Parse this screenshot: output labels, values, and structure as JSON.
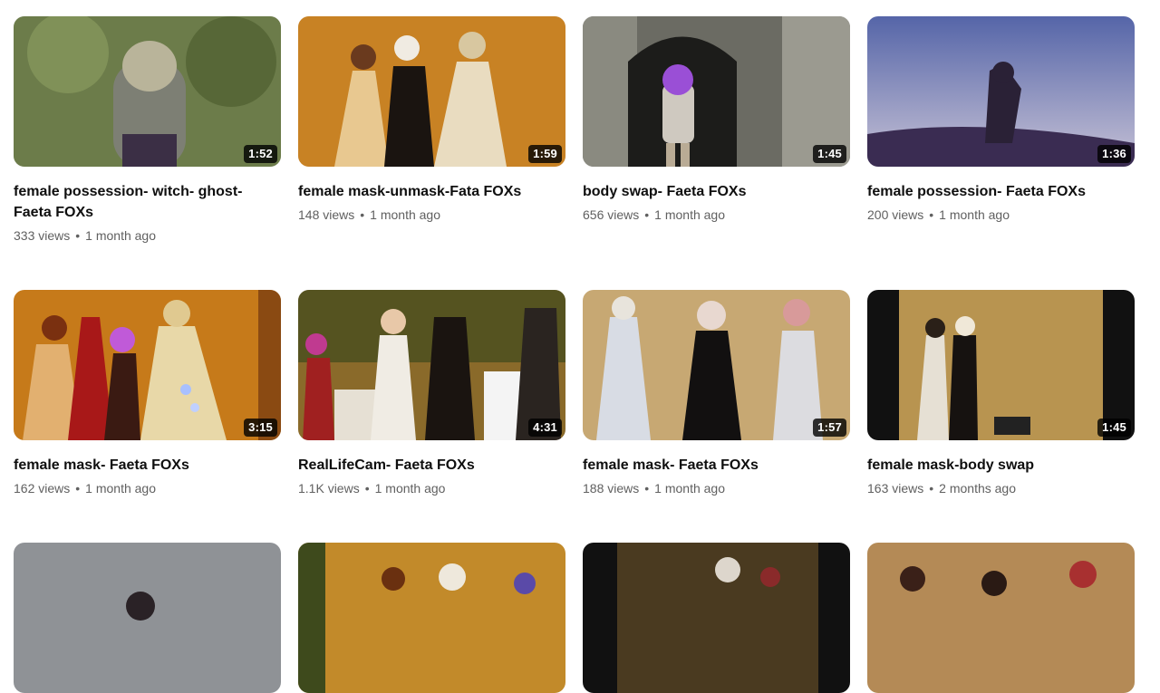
{
  "videos": [
    {
      "title": "female possession- witch- ghost- Faeta FOXs",
      "duration": "1:52",
      "views": "333 views",
      "age": "1 month ago",
      "bg": "#5c6e3e"
    },
    {
      "title": "female mask-unmask-Fata FOXs",
      "duration": "1:59",
      "views": "148 views",
      "age": "1 month ago",
      "bg": "#b8741e"
    },
    {
      "title": "body swap- Faeta FOXs",
      "duration": "1:45",
      "views": "656 views",
      "age": "1 month ago",
      "bg": "#6b6b63"
    },
    {
      "title": "female possession- Faeta FOXs",
      "duration": "1:36",
      "views": "200 views",
      "age": "1 month ago",
      "bg": "#7d86b3"
    },
    {
      "title": "female mask- Faeta FOXs",
      "duration": "3:15",
      "views": "162 views",
      "age": "1 month ago",
      "bg": "#c67a1a"
    },
    {
      "title": "RealLifeCam- Faeta FOXs",
      "duration": "4:31",
      "views": "1.1K views",
      "age": "1 month ago",
      "bg": "#8a6a2a"
    },
    {
      "title": "female mask- Faeta FOXs",
      "duration": "1:57",
      "views": "188 views",
      "age": "1 month ago",
      "bg": "#c7a873"
    },
    {
      "title": "female mask-body swap",
      "duration": "1:45",
      "views": "163 views",
      "age": "2 months ago",
      "bg": "#b89450"
    },
    {
      "title": "",
      "duration": "",
      "views": "",
      "age": "",
      "bg": "#8f9296"
    },
    {
      "title": "",
      "duration": "",
      "views": "",
      "age": "",
      "bg": "#c28a2a"
    },
    {
      "title": "",
      "duration": "",
      "views": "",
      "age": "",
      "bg": "#4a3a20"
    },
    {
      "title": "",
      "duration": "",
      "views": "",
      "age": "",
      "bg": "#b48a56"
    }
  ]
}
